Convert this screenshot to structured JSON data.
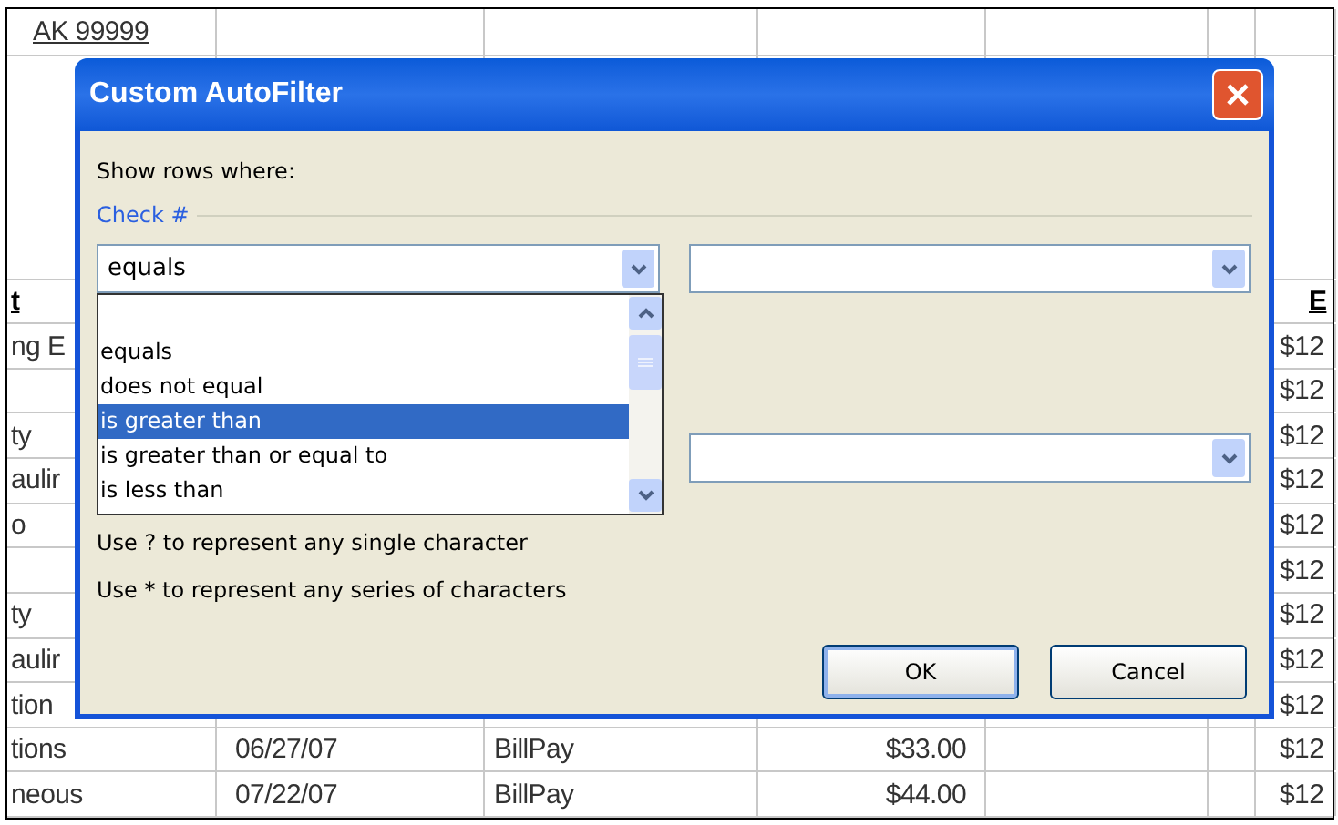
{
  "sheet": {
    "rows": [
      {
        "column_1": "AK 99999"
      },
      {},
      {
        "column_1": "t",
        "column_7": "E",
        "kind": "header"
      },
      {
        "column_1": "ng E",
        "column_7": "$12"
      },
      {
        "column_7": "$12"
      },
      {
        "column_1": "ty",
        "column_7": "$12"
      },
      {
        "column_1": "aulir",
        "column_7": "$12"
      },
      {
        "column_1": "o",
        "column_7": "$12"
      },
      {
        "column_7": "$12"
      },
      {
        "column_1": "ty",
        "column_7": "$12"
      },
      {
        "column_1": "aulir",
        "column_7": "$12"
      },
      {
        "column_1": "tion",
        "column_7": "$12"
      },
      {
        "column_1": "tions",
        "column_2": "06/27/07",
        "column_3": "BillPay",
        "column_4": "$33.00",
        "column_7": "$12"
      },
      {
        "column_1": "neous",
        "column_2": "07/22/07",
        "column_3": "BillPay",
        "column_4": "$44.00",
        "column_7": "$12"
      }
    ]
  },
  "dialog": {
    "title": "Custom AutoFilter",
    "prompt": "Show rows where:",
    "field_label": "Check #",
    "fields": [
      {
        "kind": "combo",
        "value": "equals"
      },
      {
        "kind": "combo"
      },
      {
        "kind": "hidden"
      },
      {
        "kind": "combo"
      }
    ],
    "dropdown": {
      "options": [
        {
          "label": "equals",
          "selected": false
        },
        {
          "label": "does not equal",
          "selected": false
        },
        {
          "label": "is greater than",
          "selected": true
        },
        {
          "label": "is greater than or equal to",
          "selected": false
        },
        {
          "label": "is less than",
          "selected": false
        }
      ]
    },
    "hints": [
      "Use ? to represent any single character",
      "Use * to represent any series of characters"
    ],
    "buttons": [
      {
        "label": "OK",
        "default": true
      },
      {
        "label": "Cancel",
        "default": false
      }
    ]
  }
}
